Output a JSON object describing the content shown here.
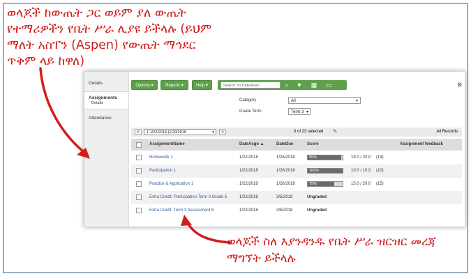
{
  "notes": {
    "top": "ወላጆች ከውጤት ጋር ወይም ያለ ውጤት የተማሪዎችን የቤት ሥራ ሊያዩ ይችላሉ (ይህም ማለት አስፐን (Aspen) የውጤት ማኅደር ጥቅም ላይ ከዋለ)",
    "bottom": "ወላጆች ስለ እያንዳንዱ የቤት ሥራ ዝርዝር መረጃ ማግኘት ይችላሉ"
  },
  "sidebar": {
    "items": [
      {
        "label": "Details"
      },
      {
        "label": "Assignments",
        "sub": "Details"
      },
      {
        "label": "Attendance"
      }
    ]
  },
  "toolbar": {
    "options_label": "Options",
    "reports_label": "Reports",
    "help_label": "Help",
    "search_placeholder": "Search on Date/Assn"
  },
  "filters": {
    "category_label": "Category",
    "category_value": "All",
    "grade_term_label": "Grade Term",
    "grade_term_value": "Term 3"
  },
  "pager": {
    "range": "1 1/22/2018 (1/29/2018",
    "selected": "0 of 23 selected",
    "all_records": "All Records"
  },
  "table": {
    "headers": [
      "AssignmentName",
      "DateAsgn ▲",
      "DateDue",
      "Score",
      "Assignment feedback"
    ],
    "rows": [
      {
        "name": "Homework 1",
        "asgn": "1/22/2018",
        "due": "1/26/2018",
        "pct": "95%",
        "fill": 0.95,
        "points": "19.0 / 20.0",
        "extra": "(19)"
      },
      {
        "name": "Participation 1",
        "asgn": "1/22/2018",
        "due": "1/26/2018",
        "pct": "100%",
        "fill": 1.0,
        "points": "10.0 / 10.0",
        "extra": "(10)"
      },
      {
        "name": "Practice & Application 1",
        "asgn": "1/22/2018",
        "due": "1/26/2018",
        "pct": "75%",
        "fill": 0.75,
        "points": "15.0 / 20.0",
        "extra": "(15)"
      },
      {
        "name": "Extra Credit: Participation Term 3 Grade 6",
        "asgn": "1/22/2018",
        "due": "3/5/2018",
        "ungraded": "Ungraded"
      },
      {
        "name": "Extra Credit: Term 3 Assessment 6",
        "asgn": "1/22/2018",
        "due": "3/5/2018",
        "ungraded": "Ungraded"
      }
    ]
  },
  "colors": {
    "annotation": "#d21d1d",
    "toolbar_green": "#5ea04b",
    "link_blue": "#2f5a9c",
    "frame": "#2b5a8a"
  }
}
